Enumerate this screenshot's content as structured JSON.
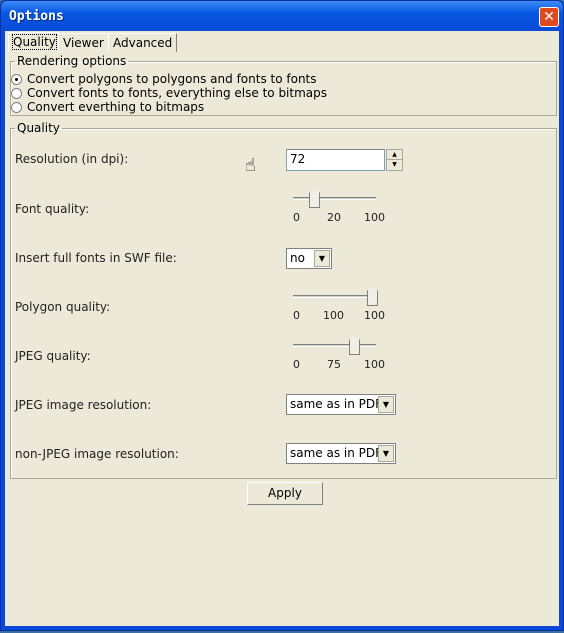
{
  "window": {
    "title": "Options",
    "close_icon": "close-icon"
  },
  "tabs": [
    {
      "label": "Quality",
      "selected": true
    },
    {
      "label": "Viewer"
    },
    {
      "label": "Advanced"
    }
  ],
  "rendering": {
    "legend": "Rendering options",
    "options": [
      {
        "label": "Convert polygons to polygons and fonts to fonts",
        "checked": true
      },
      {
        "label": "Convert fonts to fonts, everything else to bitmaps",
        "checked": false
      },
      {
        "label": "Convert everthing to bitmaps",
        "checked": false
      }
    ]
  },
  "quality": {
    "legend": "Quality",
    "resolution": {
      "label": "Resolution (in dpi):",
      "value": "72"
    },
    "font_quality": {
      "label": "Font quality:",
      "min": "0",
      "value": "20",
      "max": "100"
    },
    "insert_fonts": {
      "label": "Insert full fonts in SWF file:",
      "value": "no"
    },
    "polygon_quality": {
      "label": "Polygon quality:",
      "min": "0",
      "value": "100",
      "max": "100"
    },
    "jpeg_quality": {
      "label": "JPEG quality:",
      "min": "0",
      "value": "75",
      "max": "100"
    },
    "jpeg_res": {
      "label": "JPEG image resolution:",
      "value": "same as in PDF"
    },
    "nonjpeg_res": {
      "label": "non-JPEG image resolution:",
      "value": "same as in PDF"
    }
  },
  "apply_label": "Apply"
}
